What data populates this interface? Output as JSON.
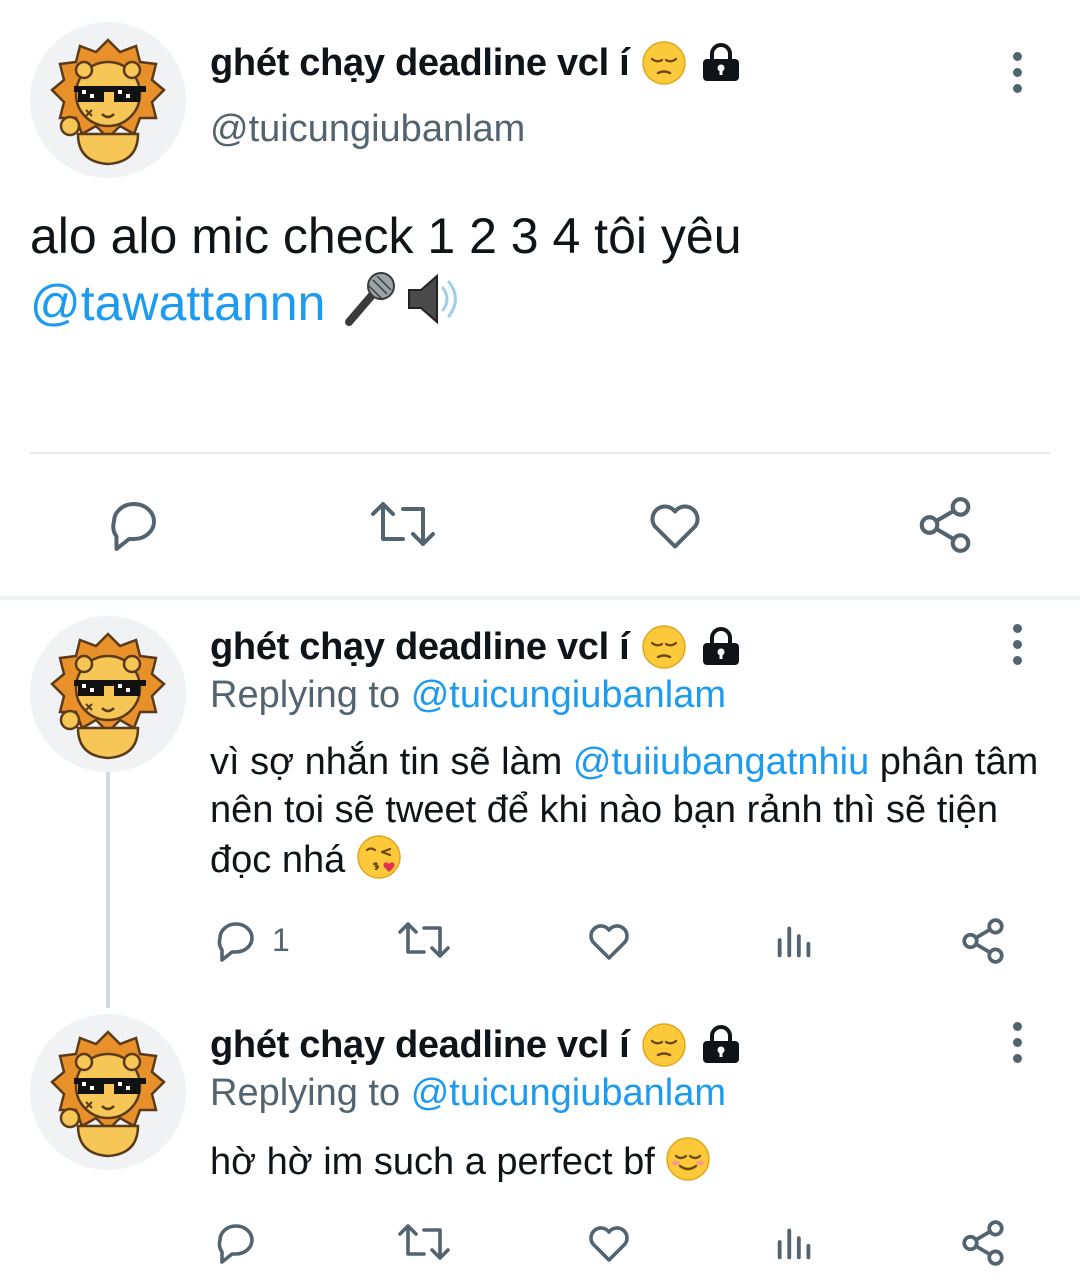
{
  "main_tweet": {
    "display_name": "ghét chạy deadline vcl í",
    "handle": "@tuicungiubanlam",
    "text_line1": "alo alo mic check 1 2 3 4 tôi yêu",
    "mention": "@tawattannn",
    "emojis": [
      "microphone-emoji",
      "speaker-emoji"
    ]
  },
  "replies": [
    {
      "display_name": "ghét chạy deadline vcl í",
      "replying_prefix": "Replying to",
      "replying_handle": "@tuicungiubanlam",
      "text_before": "vì sợ nhắn tin sẽ làm",
      "mention": "@tuiiubangatnhiu",
      "text_after": "phân tâm nên toi sẽ tweet để khi nào bạn rảnh thì sẽ tiện đọc nhá",
      "reply_count": "1"
    },
    {
      "display_name": "ghét chạy deadline vcl í",
      "replying_prefix": "Replying to",
      "replying_handle": "@tuicungiubanlam",
      "text": "hờ hờ im such a perfect bf"
    }
  ],
  "colors": {
    "accent": "#1d9bf0",
    "secondary": "#536471",
    "text": "#0f1419"
  }
}
